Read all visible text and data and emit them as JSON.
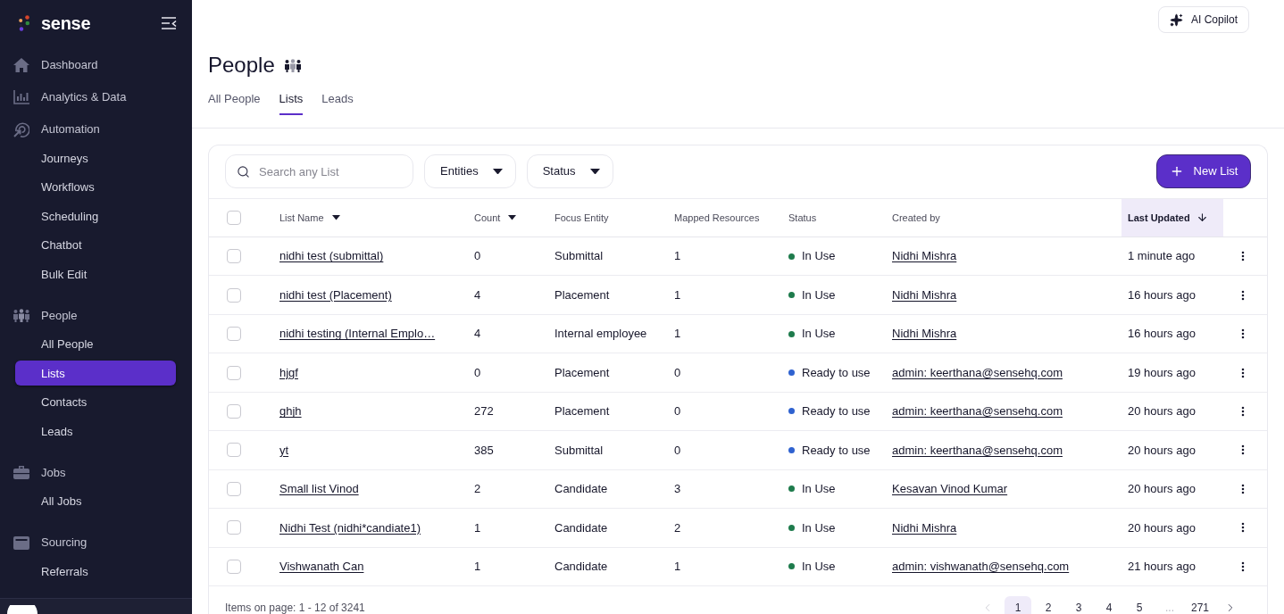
{
  "sidebar": {
    "logo": "sense",
    "sections": [
      {
        "label": "Dashboard",
        "selected": false
      },
      {
        "label": "Analytics & Data",
        "selected": false
      },
      {
        "label": "Automation",
        "selected": false,
        "children": [
          {
            "label": "Journeys",
            "selected": false
          },
          {
            "label": "Workflows",
            "selected": false
          },
          {
            "label": "Scheduling",
            "selected": false
          },
          {
            "label": "Chatbot",
            "selected": false
          },
          {
            "label": "Bulk Edit",
            "selected": false
          }
        ]
      },
      {
        "label": "People",
        "selected": false,
        "children": [
          {
            "label": "All People",
            "selected": false
          },
          {
            "label": "Lists",
            "selected": true
          },
          {
            "label": "Contacts",
            "selected": false
          },
          {
            "label": "Leads",
            "selected": false
          }
        ]
      },
      {
        "label": "Jobs",
        "selected": false,
        "children": [
          {
            "label": "All Jobs",
            "selected": false
          }
        ]
      },
      {
        "label": "Sourcing",
        "selected": false,
        "children": [
          {
            "label": "Referrals",
            "selected": false
          }
        ]
      }
    ]
  },
  "header": {
    "ai_button": "AI Copilot"
  },
  "page": {
    "title": "People",
    "tabs": [
      {
        "label": "All People",
        "selected": false
      },
      {
        "label": "Lists",
        "selected": true
      },
      {
        "label": "Leads",
        "selected": false
      }
    ]
  },
  "toolbar": {
    "search": {
      "placeholder": "Search any List"
    },
    "filters": [
      "Entities",
      "Status"
    ],
    "new_button": "New List"
  },
  "table": {
    "select_all": {
      "checked": false
    },
    "columns": [
      {
        "label": "List Name",
        "kind": "menu"
      },
      {
        "label": "Count",
        "kind": "menu"
      },
      {
        "label": "Focus Entity",
        "kind": "plain"
      },
      {
        "label": "Mapped Resources",
        "kind": "plain"
      },
      {
        "label": "Status",
        "kind": "plain"
      },
      {
        "label": "Created by",
        "kind": "plain"
      },
      {
        "label": "Last Updated",
        "kind": "sorted"
      }
    ],
    "rows": [
      {
        "checked": false,
        "name": "nidhi test (submittal)",
        "count": "0",
        "focus_entity": "Submittal",
        "mapped_resources": "1",
        "status": {
          "label": "In Use",
          "color": "#1e7b4c"
        },
        "created_by": "Nidhi Mishra",
        "last_updated": "1 minute ago"
      },
      {
        "checked": false,
        "name": "nidhi test (Placement)",
        "count": "4",
        "focus_entity": "Placement",
        "mapped_resources": "1",
        "status": {
          "label": "In Use",
          "color": "#1e7b4c"
        },
        "created_by": "Nidhi Mishra",
        "last_updated": "16 hours ago"
      },
      {
        "checked": false,
        "name": "nidhi testing (Internal Emplo…",
        "count": "4",
        "focus_entity": "Internal employee",
        "mapped_resources": "1",
        "status": {
          "label": "In Use",
          "color": "#1e7b4c"
        },
        "created_by": "Nidhi Mishra",
        "last_updated": "16 hours ago"
      },
      {
        "checked": false,
        "name": "hjgf",
        "count": "0",
        "focus_entity": "Placement",
        "mapped_resources": "0",
        "status": {
          "label": "Ready to use",
          "color": "#2f62d0"
        },
        "created_by": "admin: keerthana@sensehq.com",
        "last_updated": "19 hours ago"
      },
      {
        "checked": false,
        "name": "ghjh",
        "count": "272",
        "focus_entity": "Placement",
        "mapped_resources": "0",
        "status": {
          "label": "Ready to use",
          "color": "#2f62d0"
        },
        "created_by": "admin: keerthana@sensehq.com",
        "last_updated": "20 hours ago"
      },
      {
        "checked": false,
        "name": "yt",
        "count": "385",
        "focus_entity": "Submittal",
        "mapped_resources": "0",
        "status": {
          "label": "Ready to use",
          "color": "#2f62d0"
        },
        "created_by": "admin: keerthana@sensehq.com",
        "last_updated": "20 hours ago"
      },
      {
        "checked": false,
        "name": "Small list Vinod",
        "count": "2",
        "focus_entity": "Candidate",
        "mapped_resources": "3",
        "status": {
          "label": "In Use",
          "color": "#1e7b4c"
        },
        "created_by": "Kesavan Vinod Kumar",
        "last_updated": "20 hours ago"
      },
      {
        "checked": false,
        "name": "Nidhi Test (nidhi*candiate1)",
        "count": "1",
        "focus_entity": "Candidate",
        "mapped_resources": "2",
        "status": {
          "label": "In Use",
          "color": "#1e7b4c"
        },
        "created_by": "Nidhi Mishra",
        "last_updated": "20 hours ago"
      },
      {
        "checked": false,
        "name": "Vishwanath Can",
        "count": "1",
        "focus_entity": "Candidate",
        "mapped_resources": "1",
        "status": {
          "label": "In Use",
          "color": "#1e7b4c"
        },
        "created_by": "admin: vishwanath@sensehq.com",
        "last_updated": "21 hours ago"
      }
    ]
  },
  "footer": {
    "summary": "Items on page: 1 - 12 of 3241",
    "pagination": {
      "prev": {
        "disabled": true
      },
      "pages": [
        {
          "label": "1",
          "kind": "page",
          "selected": true
        },
        {
          "label": "2",
          "kind": "page",
          "selected": false
        },
        {
          "label": "3",
          "kind": "page",
          "selected": false
        },
        {
          "label": "4",
          "kind": "page",
          "selected": false
        },
        {
          "label": "5",
          "kind": "page",
          "selected": false
        },
        {
          "label": "...",
          "kind": "ellipsis",
          "selected": false
        },
        {
          "label": "271",
          "kind": "page",
          "selected": false
        }
      ],
      "next": {
        "disabled": false
      }
    }
  }
}
